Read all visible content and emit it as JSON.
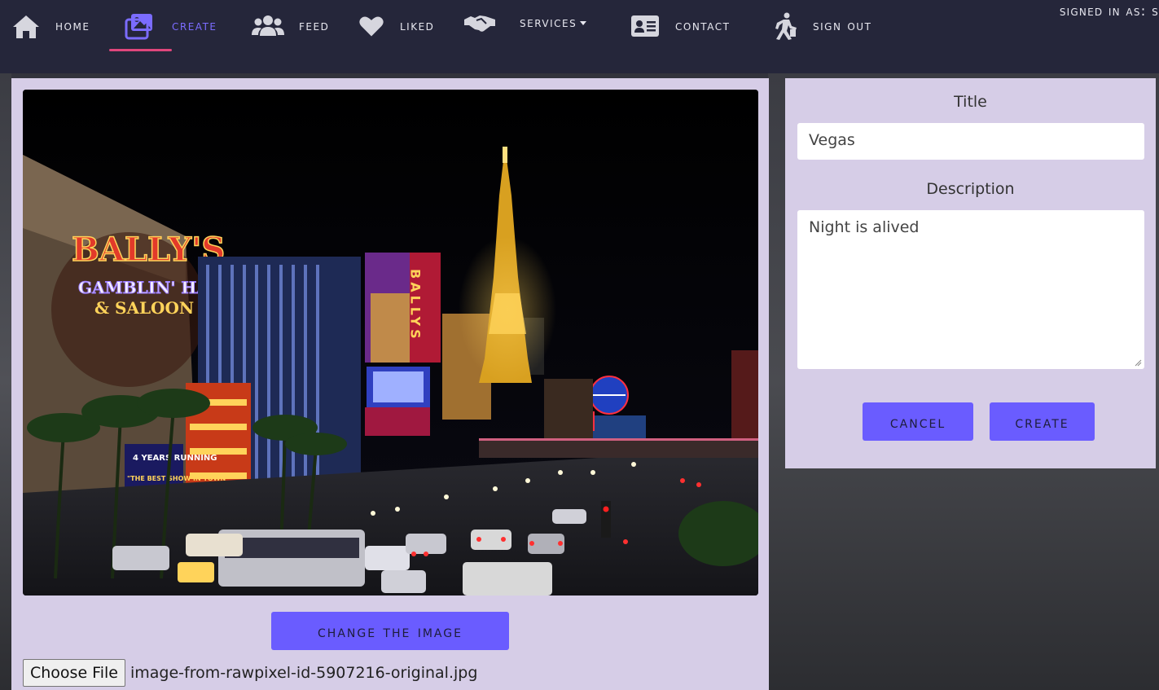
{
  "navbar": {
    "items": [
      {
        "label": "Home",
        "icon": "home-icon"
      },
      {
        "label": "Create",
        "icon": "images-icon",
        "active": true
      },
      {
        "label": "Feed",
        "icon": "users-icon"
      },
      {
        "label": "Liked",
        "icon": "heart-icon"
      },
      {
        "label": "services",
        "icon": "handshake-icon",
        "dropdown": true
      },
      {
        "label": "Contact",
        "icon": "address-card-icon"
      },
      {
        "label": "Sign out",
        "icon": "walking-icon"
      }
    ],
    "signed_in_text": "Signed in as: s",
    "active_color": "#7b6cff",
    "underline_color": "#e0467c"
  },
  "image_panel": {
    "image_alt": "Las Vegas Strip at night",
    "sign_text": [
      "BALLY'S",
      "GAMBLIN' HALL",
      "& SALOON",
      "BALLYS",
      "4 YEARS RUNNING",
      "\"THE BEST SHOW IN TOWN\""
    ],
    "change_button": "Change the image",
    "choose_file_button": "Choose File",
    "file_name": "image-from-rawpixel-id-5907216-original.jpg"
  },
  "form": {
    "title_label": "Title",
    "title_value": "Vegas",
    "description_label": "Description",
    "description_value": "Night is alived",
    "cancel_button": "Cancel",
    "create_button": "Create"
  },
  "colors": {
    "navbar_bg": "#25263a",
    "card_bg": "#d6cde7",
    "button_bg": "#6a5cff"
  }
}
